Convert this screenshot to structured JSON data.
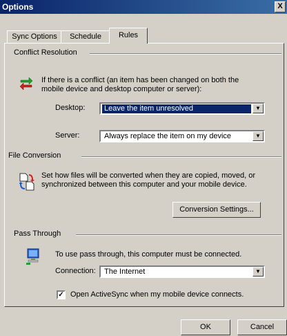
{
  "window": {
    "title": "Options",
    "close_glyph": "X"
  },
  "tabs": [
    {
      "label": "Sync Options",
      "active": false
    },
    {
      "label": "Schedule",
      "active": false
    },
    {
      "label": "Rules",
      "active": true
    }
  ],
  "conflict": {
    "group_label": "Conflict Resolution",
    "description": "If there is a conflict (an item has been changed on both the mobile device and desktop computer or server):",
    "desktop_label": "Desktop:",
    "desktop_value": "Leave the item unresolved",
    "server_label": "Server:",
    "server_value": "Always replace the item on my device",
    "icon": "sync-arrows-icon"
  },
  "file_conversion": {
    "group_label": "File Conversion",
    "description": "Set how files will be converted when they are copied, moved, or synchronized between this computer and your mobile device.",
    "button_label": "Conversion Settings...",
    "icon": "file-convert-icon"
  },
  "pass_through": {
    "group_label": "Pass Through",
    "description": "To use pass through, this computer must be connected.",
    "connection_label": "Connection:",
    "connection_value": "The Internet",
    "checkbox_label": "Open ActiveSync when my mobile device connects.",
    "checkbox_checked": true,
    "icon": "network-computer-icon"
  },
  "footer": {
    "ok_label": "OK",
    "cancel_label": "Cancel"
  },
  "colors": {
    "titlebar": "#0a246a",
    "face": "#d4d0c8",
    "selection": "#0a246a"
  }
}
